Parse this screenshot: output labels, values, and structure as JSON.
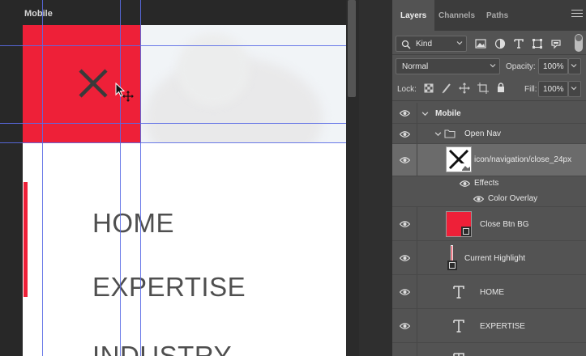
{
  "canvas": {
    "artboard_label": "Mobile",
    "nav_items": [
      "HOME",
      "EXPERTISE",
      "INDUSTRY"
    ]
  },
  "panel": {
    "tabs": [
      "Layers",
      "Channels",
      "Paths"
    ],
    "active_tab": "Layers",
    "filter": {
      "kind_label": "Kind"
    },
    "blend_mode": "Normal",
    "opacity_label": "Opacity:",
    "opacity_value": "100%",
    "lock_label": "Lock:",
    "fill_label": "Fill:",
    "fill_value": "100%"
  },
  "layers": [
    {
      "name": "Mobile",
      "type": "artboard"
    },
    {
      "name": "Open Nav",
      "type": "group"
    },
    {
      "name": "icon/navigation/close_24px",
      "type": "smart-object",
      "selected": true
    },
    {
      "name": "Effects",
      "type": "effects-header"
    },
    {
      "name": "Color Overlay",
      "type": "effect"
    },
    {
      "name": "Close Btn BG",
      "type": "shape"
    },
    {
      "name": "Current Highlight",
      "type": "shape"
    },
    {
      "name": "HOME",
      "type": "text"
    },
    {
      "name": "EXPERTISE",
      "type": "text"
    }
  ],
  "colors": {
    "accent_red": "#ee2038",
    "guide_blue": "#5a6be6",
    "panel_bg": "#535353",
    "selected_row": "#6b6b6b"
  }
}
